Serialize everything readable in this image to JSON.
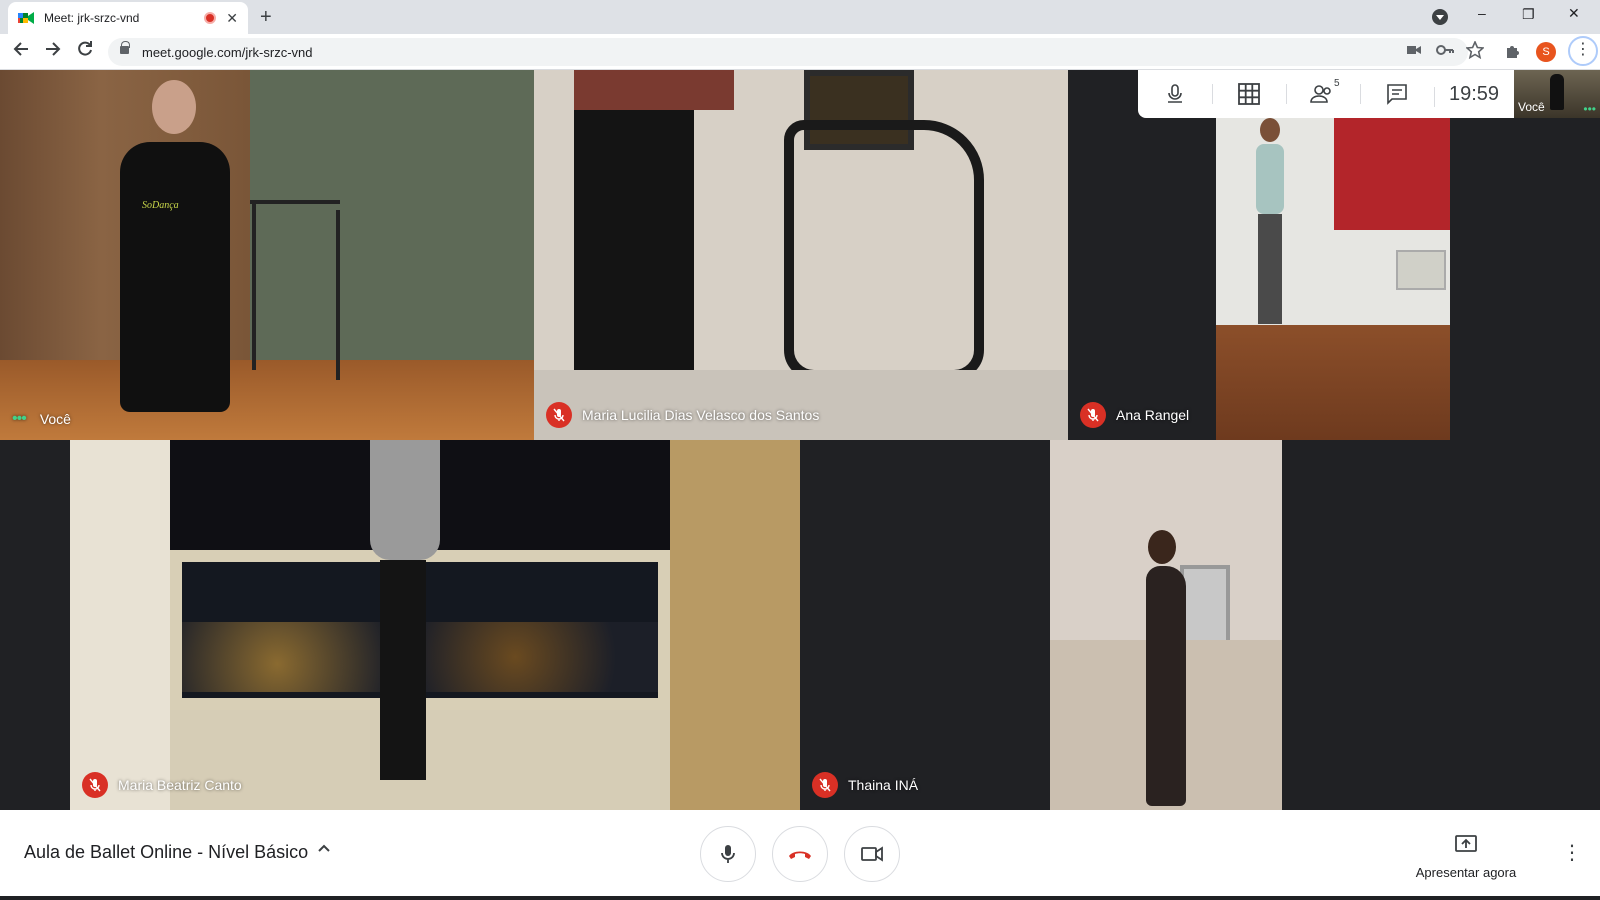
{
  "browser": {
    "tab_title": "Meet: jrk-srzc-vnd",
    "tab_close": "✕",
    "new_tab": "+",
    "url": "meet.google.com/jrk-srzc-vnd",
    "profile_initial": "S",
    "window_controls": [
      "–",
      "❐",
      "✕"
    ],
    "accent": "#1a73e8"
  },
  "meet_bar": {
    "clock": "19:59",
    "participants_count": "5",
    "self_label": "Você"
  },
  "tiles": [
    {
      "name": "Você",
      "muted": false,
      "speaking_indicator": true
    },
    {
      "name": "Maria Lucilia Dias Velasco dos Santos",
      "muted": true
    },
    {
      "name": "Ana Rangel",
      "muted": true
    },
    {
      "name": "Maria Beatriz Canto",
      "muted": true
    },
    {
      "name": "Thaina INÁ",
      "muted": true
    }
  ],
  "shirt_text": "SoDança",
  "bottom": {
    "meeting_title": "Aula de Ballet Online - Nível Básico",
    "present_label": "Apresentar agora"
  },
  "colors": {
    "mute_red": "#d93025",
    "speaking_green": "#41d28a",
    "background": "#202124"
  }
}
